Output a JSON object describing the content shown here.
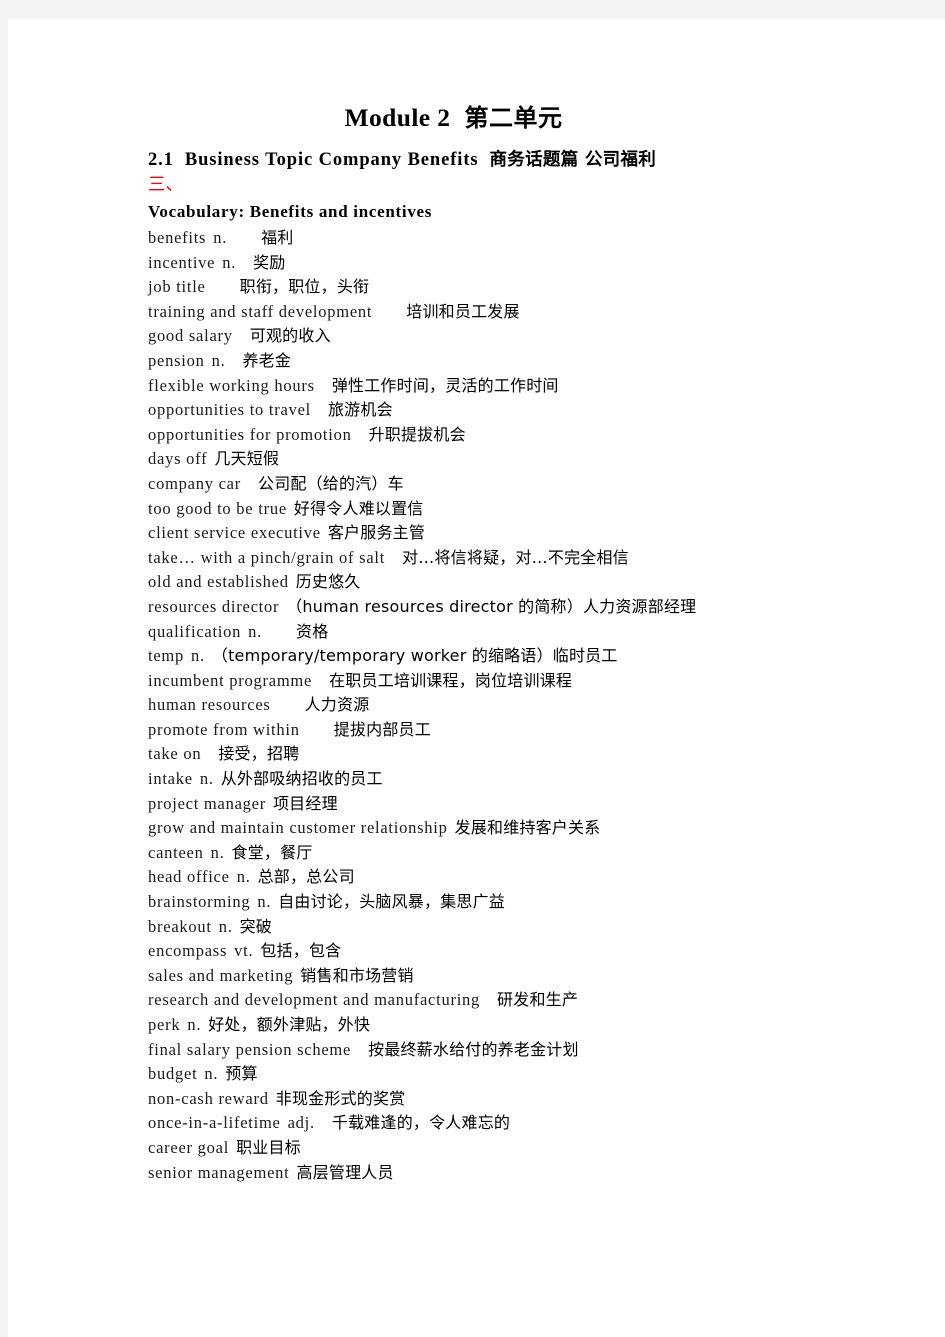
{
  "page": {
    "title_en": "Module 2",
    "title_cjk": "第二单元",
    "subtitle_num": "2.1",
    "subtitle_en": "Business Topic   Company Benefits",
    "subtitle_cjk": "商务话题篇 公司福利",
    "section_marker": "三、",
    "vocab_heading": "Vocabulary:  Benefits  and  incentives",
    "accent_color": "#ff0000",
    "text_color": "#1a1a1a",
    "page_background": "#ffffff",
    "canvas_background": "#f4f4f4"
  },
  "vocabulary": [
    {
      "term": "benefits",
      "pos": "n.",
      "gap": "lg",
      "gloss": "福利"
    },
    {
      "term": "incentive",
      "pos": "n.",
      "gap": "md",
      "gloss": "奖励"
    },
    {
      "term": "job title",
      "pos": "",
      "gap": "lg",
      "gloss": "职衔，职位，头衔"
    },
    {
      "term": "training and staff development",
      "pos": "",
      "gap": "lg",
      "gloss": "培训和员工发展"
    },
    {
      "term": "good salary",
      "pos": "",
      "gap": "md",
      "gloss": "可观的收入"
    },
    {
      "term": "pension",
      "pos": "n.",
      "gap": "md",
      "gloss": "养老金"
    },
    {
      "term": "flexible working hours",
      "pos": "",
      "gap": "md",
      "gloss": "弹性工作时间，灵活的工作时间"
    },
    {
      "term": "opportunities to travel",
      "pos": "",
      "gap": "md",
      "gloss": "旅游机会"
    },
    {
      "term": "opportunities for promotion",
      "pos": "",
      "gap": "md",
      "gloss": "升职提拔机会"
    },
    {
      "term": "days off",
      "pos": "",
      "gap": "sm",
      "gloss": "几天短假"
    },
    {
      "term": "company car",
      "pos": "",
      "gap": "md",
      "gloss": "公司配（给的汽）车"
    },
    {
      "term": "too good to be true",
      "pos": "",
      "gap": "sm",
      "gloss": "好得令人难以置信"
    },
    {
      "term": "client service executive",
      "pos": "",
      "gap": "sm",
      "gloss": "客户服务主管"
    },
    {
      "term": "take… with a pinch/grain of salt",
      "pos": "",
      "gap": "md",
      "gloss": "对…将信将疑，对…不完全相信"
    },
    {
      "term": "old and established",
      "pos": "",
      "gap": "sm",
      "gloss": "历史悠久"
    },
    {
      "term": "resources director",
      "pos": "",
      "gap": "sm",
      "gloss": "（human resources director 的简称）人力资源部经理"
    },
    {
      "term": "qualification",
      "pos": "n.",
      "gap": "lg",
      "gloss": "资格"
    },
    {
      "term": "temp",
      "pos": "n.",
      "gap": "sm",
      "gloss": "（temporary/temporary worker 的缩略语）临时员工"
    },
    {
      "term": "incumbent programme",
      "pos": "",
      "gap": "md",
      "gloss": "在职员工培训课程，岗位培训课程"
    },
    {
      "term": "human resources",
      "pos": "",
      "gap": "lg",
      "gloss": "人力资源"
    },
    {
      "term": "promote from within",
      "pos": "",
      "gap": "lg",
      "gloss": "提拔内部员工"
    },
    {
      "term": "take on",
      "pos": "",
      "gap": "md",
      "gloss": "接受，招聘"
    },
    {
      "term": "intake",
      "pos": "n.",
      "gap": "sm",
      "gloss": "从外部吸纳招收的员工"
    },
    {
      "term": "project manager",
      "pos": "",
      "gap": "sm",
      "gloss": "项目经理"
    },
    {
      "term": "grow and maintain customer relationship",
      "pos": "",
      "gap": "sm",
      "gloss": "发展和维持客户关系"
    },
    {
      "term": "canteen",
      "pos": "n.",
      "gap": "sm",
      "gloss": "食堂，餐厅"
    },
    {
      "term": "head office",
      "pos": "n.",
      "gap": "sm",
      "gloss": "总部，总公司"
    },
    {
      "term": "brainstorming",
      "pos": "n.",
      "gap": "sm",
      "gloss": "自由讨论，头脑风暴，集思广益"
    },
    {
      "term": "breakout",
      "pos": "n.",
      "gap": "sm",
      "gloss": "突破"
    },
    {
      "term": "encompass",
      "pos": "vt.",
      "gap": "sm",
      "gloss": "包括，包含"
    },
    {
      "term": "sales and marketing",
      "pos": "",
      "gap": "sm",
      "gloss": "销售和市场营销"
    },
    {
      "term": "research and development and manufacturing",
      "pos": "",
      "gap": "md",
      "gloss": "研发和生产"
    },
    {
      "term": "perk",
      "pos": "n.",
      "gap": "sm",
      "gloss": "好处，额外津贴，外快"
    },
    {
      "term": "final salary pension scheme",
      "pos": "",
      "gap": "md",
      "gloss": "按最终薪水给付的养老金计划"
    },
    {
      "term": "budget",
      "pos": "n.",
      "gap": "sm",
      "gloss": "预算"
    },
    {
      "term": "non-cash reward",
      "pos": "",
      "gap": "sm",
      "gloss": "非现金形式的奖赏"
    },
    {
      "term": "once-in-a-lifetime",
      "pos": "adj.",
      "gap": "md",
      "gloss": "千载难逢的，令人难忘的"
    },
    {
      "term": "career goal",
      "pos": "",
      "gap": "sm",
      "gloss": "职业目标"
    },
    {
      "term": "senior management",
      "pos": "",
      "gap": "sm",
      "gloss": "高层管理人员"
    }
  ]
}
